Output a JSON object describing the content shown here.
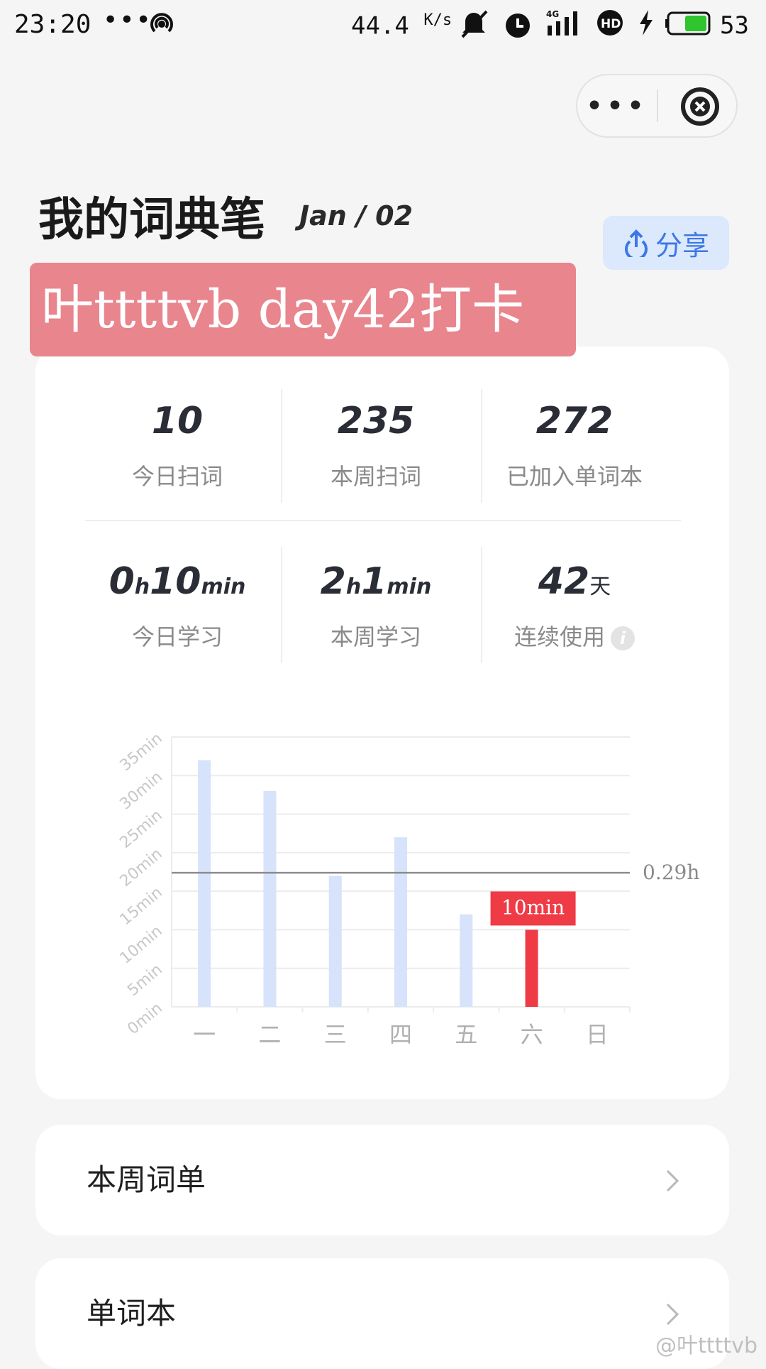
{
  "status_bar": {
    "time": "23:20",
    "dots": "•••",
    "net_speed": "44.4",
    "net_speed_unit": "K/s",
    "battery_level": "53",
    "icons": [
      "hotspot-icon",
      "mute-icon",
      "alarm-icon",
      "signal-4g-icon",
      "hd-icon",
      "charging-icon",
      "battery-icon"
    ]
  },
  "capsule": {
    "more": "•••",
    "close_icon": "close-icon"
  },
  "header": {
    "title": "我的词典笔",
    "date": "Jan / 02",
    "share_label": "分享",
    "share_icon": "upload-icon"
  },
  "watermark": "叶ttttvb day42打卡",
  "stats": [
    {
      "value": "10",
      "label": "今日扫词"
    },
    {
      "value": "235",
      "label": "本周扫词"
    },
    {
      "value": "272",
      "label": "已加入单词本"
    }
  ],
  "study": {
    "today": {
      "h": "0",
      "h_unit": "h",
      "m": "10",
      "m_unit": "min",
      "label": "今日学习"
    },
    "week": {
      "h": "2",
      "h_unit": "h",
      "m": "1",
      "m_unit": "min",
      "label": "本周学习"
    },
    "streak": {
      "value": "42",
      "unit": "天",
      "label": "连续使用"
    }
  },
  "chart_data": {
    "type": "bar",
    "categories": [
      "一",
      "二",
      "三",
      "四",
      "五",
      "六",
      "日"
    ],
    "values": [
      32,
      28,
      17,
      22,
      12,
      10,
      0
    ],
    "highlight_index": 5,
    "highlight_label": "10min",
    "y_ticks": [
      "0min",
      "5min",
      "10min",
      "15min",
      "20min",
      "25min",
      "30min",
      "35min"
    ],
    "ylim": [
      0,
      35
    ],
    "average_line_value": 17.4,
    "average_label": "0.29h",
    "colors": {
      "bar": "#d6e3fb",
      "highlight": "#ef3b45",
      "avg_line": "#8c8c8c",
      "grid": "#ececec",
      "tick": "#c8c8c8"
    }
  },
  "list": [
    {
      "label": "本周词单"
    },
    {
      "label": "单词本"
    }
  ],
  "weibo_watermark": "@叶ttttvb"
}
